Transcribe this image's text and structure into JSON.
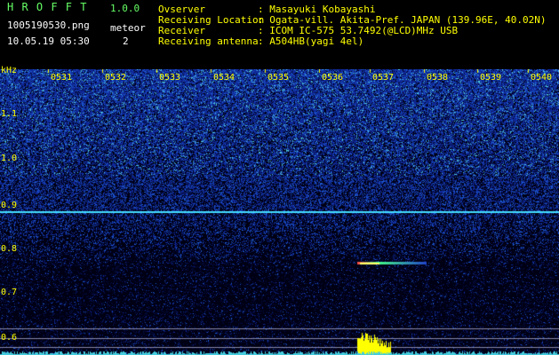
{
  "app": {
    "name": "H R O F F T",
    "version": "1.0.0",
    "file": "1005190530.png",
    "datetime": "10.05.19 05:30",
    "meteor_label": "meteor",
    "meteor_count": "2"
  },
  "info": [
    {
      "label": "Ovserver",
      "value": ": Masayuki Kobayashi"
    },
    {
      "label": "Receiving Location",
      "value": ": Ogata-vill. Akita-Pref. JAPAN (139.96E, 40.02N)"
    },
    {
      "label": "Receiver",
      "value": ": ICOM IC-575 53.7492(@LCD)MHz USB"
    },
    {
      "label": "Receiving antenna",
      "value": ": A504HB(yagi 4el)"
    }
  ],
  "axis": {
    "unit": "kHz",
    "x_ticks": [
      "0531",
      "0532",
      "0533",
      "0534",
      "0535",
      "0536",
      "0537",
      "0538",
      "0539",
      "0540"
    ],
    "y_ticks": [
      "1.1",
      "1.0",
      "0.9",
      "0.8",
      "0.7",
      "0.6"
    ]
  },
  "colors": {
    "background": "#000000",
    "text": "#ffff00",
    "title": "#66ff66",
    "spectrum_high": "#2244cc",
    "carrier_line": "#44ddff",
    "meteor_echo": "#ffff00"
  }
}
